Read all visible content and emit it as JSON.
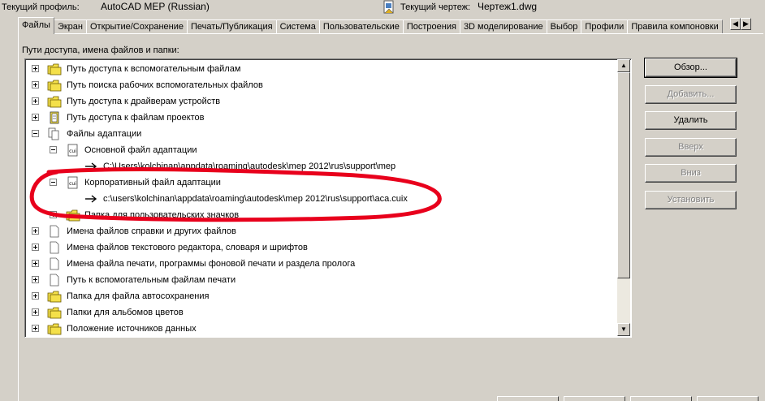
{
  "profile": {
    "current_profile_label": "Текущий профиль:",
    "current_profile_value": "AutoCAD MEP (Russian)",
    "current_drawing_label": "Текущий чертеж:",
    "current_drawing_value": "Чертеж1.dwg"
  },
  "tabs": [
    "Файлы",
    "Экран",
    "Открытие/Сохранение",
    "Печать/Публикация",
    "Система",
    "Пользовательские",
    "Построения",
    "3D моделирование",
    "Выбор",
    "Профили",
    "Правила компоновки"
  ],
  "active_tab": "Файлы",
  "group_label": "Пути доступа, имена файлов и папки:",
  "tree": [
    {
      "label": "Путь доступа к вспомогательным файлам",
      "icon": "folder-icon",
      "expander": "plus"
    },
    {
      "label": "Путь поиска рабочих вспомогательных файлов",
      "icon": "folder-icon",
      "expander": "plus"
    },
    {
      "label": "Путь доступа к драйверам устройств",
      "icon": "folder-icon",
      "expander": "plus"
    },
    {
      "label": "Путь доступа к файлам проектов",
      "icon": "project-icon",
      "expander": "plus"
    },
    {
      "label": "Файлы адаптации",
      "icon": "files-icon",
      "expander": "minus"
    },
    {
      "label": "Основной файл адаптации",
      "icon": "cui-icon",
      "expander": "minus"
    },
    {
      "label": "C:\\Users\\kolchinan\\appdata\\roaming\\autodesk\\mep 2012\\rus\\support\\mep",
      "icon": "arrow-icon",
      "expander": ""
    },
    {
      "label": "Корпоративный файл адаптации",
      "icon": "cui-icon",
      "expander": "minus"
    },
    {
      "label": "c:\\users\\kolchinan\\appdata\\roaming\\autodesk\\mep 2012\\rus\\support\\aca.cuix",
      "icon": "arrow-icon",
      "expander": ""
    },
    {
      "label": "Папка для пользовательских значков",
      "icon": "folder-icon",
      "expander": "plus"
    },
    {
      "label": "Имена файлов справки и других файлов",
      "icon": "file-icon",
      "expander": "plus"
    },
    {
      "label": "Имена файлов текстового редактора, словаря и шрифтов",
      "icon": "file-icon",
      "expander": "plus"
    },
    {
      "label": "Имена файла печати, программы фоновой печати и раздела пролога",
      "icon": "file-icon",
      "expander": "plus"
    },
    {
      "label": "Путь к вспомогательным файлам печати",
      "icon": "file-icon",
      "expander": "plus"
    },
    {
      "label": "Папка для файла автосохранения",
      "icon": "folder-icon",
      "expander": "plus"
    },
    {
      "label": "Папки для альбомов цветов",
      "icon": "folder-icon",
      "expander": "plus"
    },
    {
      "label": "Положение источников данных",
      "icon": "folder-icon",
      "expander": "plus"
    }
  ],
  "buttons": {
    "browse": "Обзор...",
    "add": "Добавить...",
    "remove": "Удалить",
    "move_up": "Вверх",
    "move_down": "Вниз",
    "set_current": "Установить"
  },
  "colors": {
    "window_bg": "#d4d0c8",
    "annotation": "#e8001c",
    "folder_yellow": "#f4e04a"
  }
}
